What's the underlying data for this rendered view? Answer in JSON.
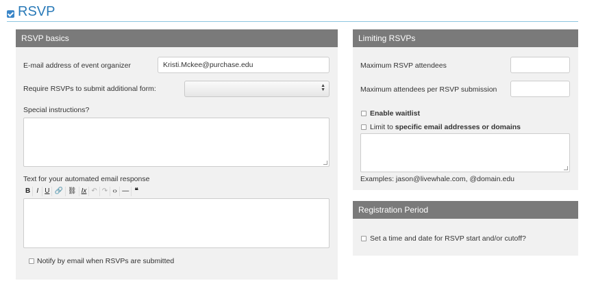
{
  "header": {
    "title": "RSVP"
  },
  "basics": {
    "title": "RSVP basics",
    "organizer_label": "E-mail address of event organizer",
    "organizer_value": "Kristi.Mckee@purchase.edu",
    "require_form_label": "Require RSVPs to submit additional form:",
    "require_form_value": "",
    "special_instructions_label": "Special instructions?",
    "email_response_label": "Text for your automated email response",
    "notify_label": "Notify by email when RSVPs are submitted"
  },
  "editor_toolbar": {
    "bold": "B",
    "italic": "I",
    "underline": "U",
    "link": "🔗",
    "unlink": "⛓",
    "clear_format": "Ix",
    "undo": "↶",
    "redo": "↷",
    "source": "‹›",
    "hr": "—",
    "quote": "❝"
  },
  "limiting": {
    "title": "Limiting RSVPs",
    "max_attendees_label": "Maximum RSVP attendees",
    "max_attendees_value": "",
    "max_per_submission_label": "Maximum attendees per RSVP submission",
    "max_per_submission_value": "",
    "waitlist_label": "Enable waitlist",
    "limit_prefix": "Limit to ",
    "limit_bold": "specific email addresses or domains",
    "examples": "Examples: jason@livewhale.com, @domain.edu"
  },
  "registration": {
    "title": "Registration Period",
    "start_cutoff_label": "Set a time and date for RSVP start and/or cutoff?"
  }
}
